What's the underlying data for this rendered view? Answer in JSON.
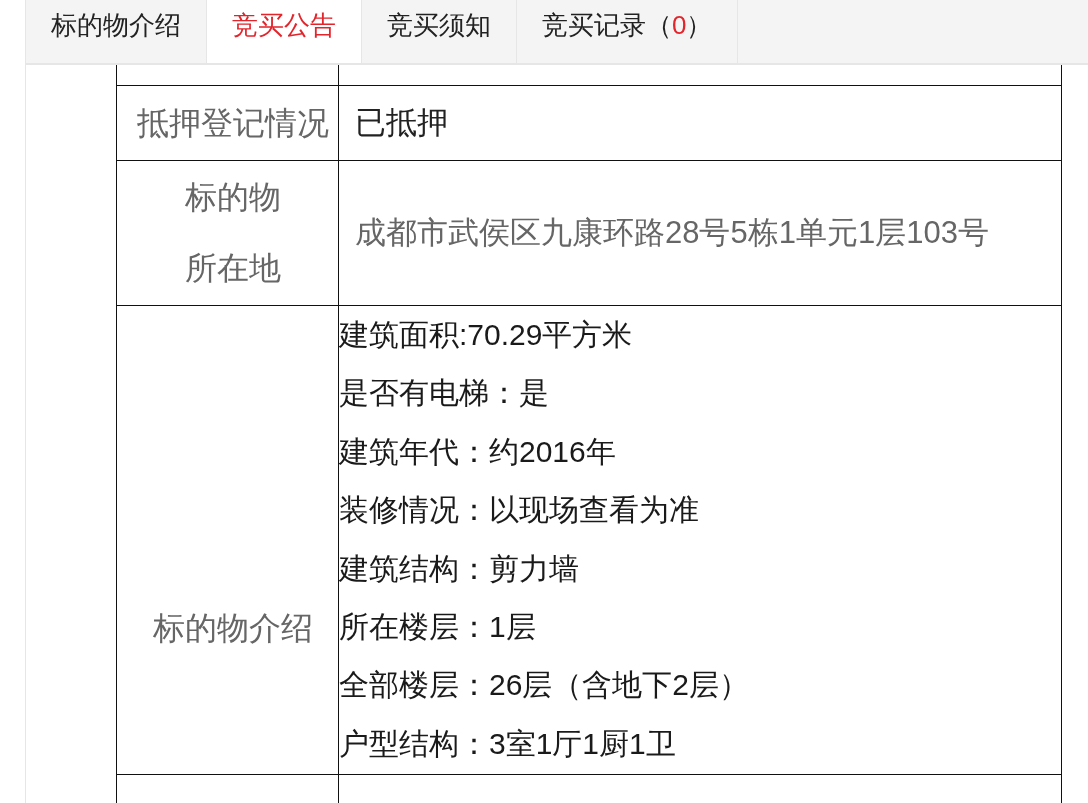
{
  "tabs": [
    {
      "label": "标的物介绍",
      "selected": false
    },
    {
      "label": "竞买公告",
      "selected": true
    },
    {
      "label": "竞买须知",
      "selected": false
    },
    {
      "label": "竞买记录（",
      "count": "0",
      "label_end": "）",
      "selected": false
    }
  ],
  "table": {
    "rows": [
      {
        "kind": "single",
        "label": "抵押登记情况",
        "value": "已抵押"
      },
      {
        "kind": "address",
        "label": "标的物所在地",
        "value": "成都市武侯区九康环路28号5栋1单元1层103号"
      },
      {
        "kind": "list",
        "label": "标的物介绍",
        "lines": [
          "建筑面积:70.29平方米",
          "是否有电梯：是",
          "建筑年代：约2016年",
          "装修情况：以现场查看为准",
          "建筑结构：剪力墙",
          "所在楼层：1层",
          "全部楼层：26层（含地下2层）",
          "户型结构：3室1厅1厨1卫"
        ]
      }
    ]
  }
}
